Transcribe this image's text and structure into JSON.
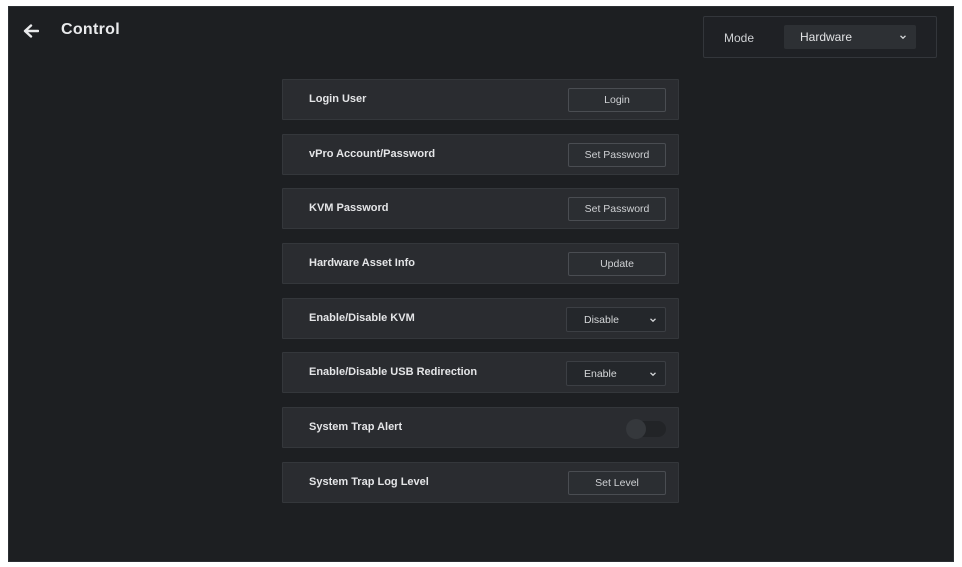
{
  "header": {
    "title": "Control",
    "back_icon": "arrow-left-icon"
  },
  "mode": {
    "label": "Mode",
    "selected": "Hardware"
  },
  "rows": [
    {
      "label": "Login User",
      "control": "button",
      "action_label": "Login"
    },
    {
      "label": "vPro Account/Password",
      "control": "button",
      "action_label": "Set Password"
    },
    {
      "label": "KVM Password",
      "control": "button",
      "action_label": "Set Password"
    },
    {
      "label": "Hardware Asset Info",
      "control": "button",
      "action_label": "Update"
    },
    {
      "label": "Enable/Disable KVM",
      "control": "select",
      "selected": "Disable"
    },
    {
      "label": "Enable/Disable USB Redirection",
      "control": "select",
      "selected": "Enable"
    },
    {
      "label": "System Trap Alert",
      "control": "toggle",
      "enabled": false
    },
    {
      "label": "System Trap Log Level",
      "control": "button",
      "action_label": "Set Level"
    }
  ],
  "colors": {
    "background": "#1d1f22",
    "row_background": "#2a2c30",
    "text": "#e4e5e7",
    "button_border": "#4a4d52"
  }
}
